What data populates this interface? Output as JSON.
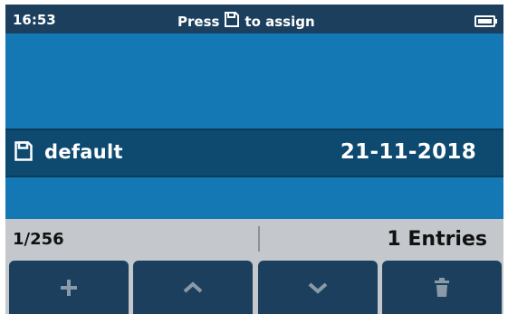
{
  "status_bar": {
    "time": "16:53",
    "hint_prefix": "Press",
    "hint_icon": "save-icon",
    "hint_suffix": "to assign",
    "battery_icon": "battery-icon"
  },
  "list": {
    "items": [
      {
        "icon": "save-icon",
        "name": "default",
        "date": "21-11-2018",
        "selected": true
      }
    ]
  },
  "info_bar": {
    "page": "1/256",
    "entries": "1 Entries"
  },
  "toolbar": {
    "buttons": [
      {
        "icon": "plus-icon"
      },
      {
        "icon": "chevron-up-icon"
      },
      {
        "icon": "chevron-down-icon"
      },
      {
        "icon": "trash-icon"
      }
    ]
  },
  "colors": {
    "background": "#1478b4",
    "dark_bar": "#1b3f5d",
    "selected_row": "#0e4a70",
    "info_bar": "#c4c8cc",
    "icon_muted": "#8a9aa8"
  }
}
